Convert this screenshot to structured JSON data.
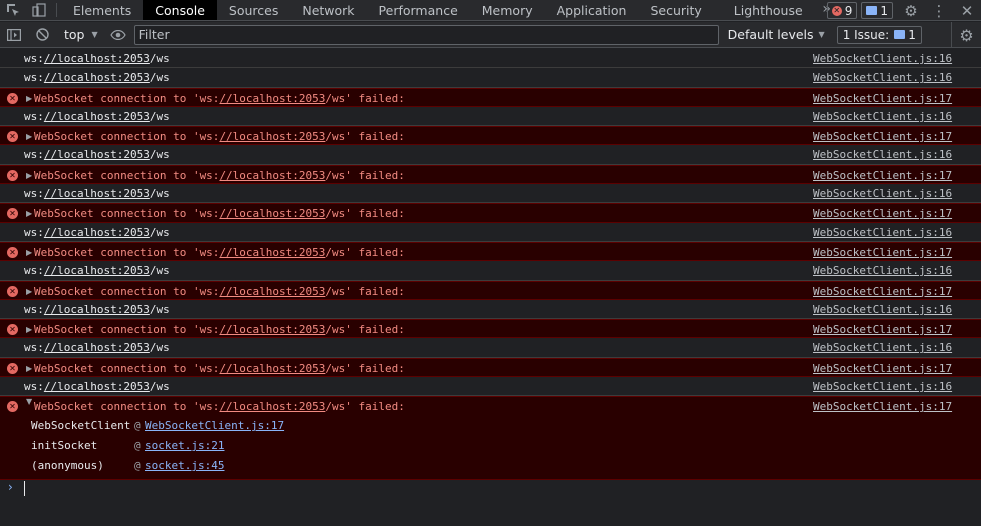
{
  "tabs": [
    "Elements",
    "Console",
    "Sources",
    "Network",
    "Performance",
    "Memory",
    "Application",
    "Security",
    "Lighthouse"
  ],
  "active_tab": "Console",
  "more_tabs": "»",
  "error_count": "9",
  "message_count": "1",
  "toolbar": {
    "context": "top",
    "filter_placeholder": "Filter",
    "levels": "Default levels",
    "issues_label": "1 Issue:",
    "issues_count": "1"
  },
  "log": {
    "ws_prefix": "ws:",
    "ws_link": "//localhost:2053",
    "ws_suffix": "/ws",
    "err_prefix": "WebSocket connection to 'ws:",
    "err_link": "//localhost:2053",
    "err_suffix": "/ws' failed:",
    "src_info": "WebSocketClient.js:16",
    "src_error": "WebSocketClient.js:17",
    "rows": [
      "info",
      "info",
      "error",
      "info",
      "error",
      "info",
      "error",
      "info",
      "error",
      "info",
      "error",
      "info",
      "error",
      "info",
      "error",
      "info",
      "error",
      "info"
    ]
  },
  "expanded_error": {
    "source": "WebSocketClient.js:17",
    "stack": [
      {
        "fn": "WebSocketClient",
        "at": "@",
        "loc": "WebSocketClient.js:17"
      },
      {
        "fn": "initSocket",
        "at": "@",
        "loc": "socket.js:21"
      },
      {
        "fn": "(anonymous)",
        "at": "@",
        "loc": "socket.js:45"
      }
    ]
  },
  "colors": {
    "error_bg": "#290000",
    "error_text": "#f28b82",
    "link_blue": "#8ab4f8"
  }
}
